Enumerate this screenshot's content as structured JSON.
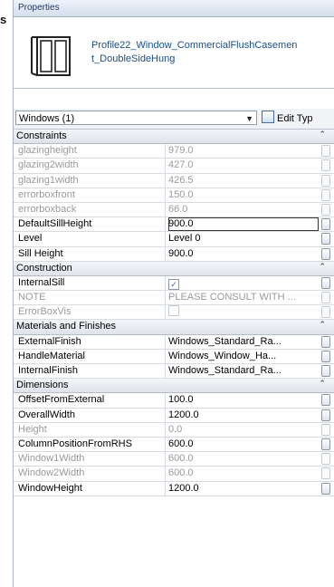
{
  "edge_text": "s",
  "title": "Properties",
  "type_name": "Profile22_Window_CommercialFlushCasement_DoubleSideHung",
  "selector": {
    "value": "Windows (1)",
    "edit_type_label": "Edit Typ"
  },
  "groups": [
    {
      "label": "Constraints",
      "rows": [
        {
          "name": "glazingheight",
          "value": "979.0",
          "state": "disabled"
        },
        {
          "name": "glazing2width",
          "value": "427.0",
          "state": "disabled"
        },
        {
          "name": "glazing1width",
          "value": "426.5",
          "state": "disabled"
        },
        {
          "name": "errorboxfront",
          "value": "150.0",
          "state": "disabled"
        },
        {
          "name": "errorboxback",
          "value": "66.0",
          "state": "disabled"
        },
        {
          "name": "DefaultSillHeight",
          "value": "900.0",
          "state": "selected"
        },
        {
          "name": "Level",
          "value": "Level 0",
          "state": "normal"
        },
        {
          "name": "Sill Height",
          "value": "900.0",
          "state": "normal"
        }
      ]
    },
    {
      "label": "Construction",
      "rows": [
        {
          "name": "InternalSill",
          "value": "",
          "state": "checkbox-checked"
        },
        {
          "name": "NOTE",
          "value": "PLEASE CONSULT WITH ...",
          "state": "disabled"
        },
        {
          "name": "ErrorBoxVis",
          "value": "",
          "state": "checkbox-disabled"
        }
      ]
    },
    {
      "label": "Materials and Finishes",
      "rows": [
        {
          "name": "ExternalFinish",
          "value": "Windows_Standard_Ra...",
          "state": "normal"
        },
        {
          "name": "HandleMaterial",
          "value": "Windows_Window_Ha...",
          "state": "normal"
        },
        {
          "name": "InternalFinish",
          "value": "Windows_Standard_Ra...",
          "state": "normal"
        }
      ]
    },
    {
      "label": "Dimensions",
      "rows": [
        {
          "name": "OffsetFromExternal",
          "value": "100.0",
          "state": "normal"
        },
        {
          "name": "OverallWidth",
          "value": "1200.0",
          "state": "normal"
        },
        {
          "name": "Height",
          "value": "0.0",
          "state": "disabled"
        },
        {
          "name": "ColumnPositionFromRHS",
          "value": "600.0",
          "state": "normal"
        },
        {
          "name": "Window1Width",
          "value": "600.0",
          "state": "disabled"
        },
        {
          "name": "Window2Width",
          "value": "600.0",
          "state": "disabled"
        },
        {
          "name": "WindowHeight",
          "value": "1200.0",
          "state": "normal"
        }
      ]
    }
  ],
  "icons": {
    "collapse": "chevron-up-icon",
    "dropdown": "chevron-down-icon",
    "edit_type": "edit-type-icon",
    "family": "window-family-thumbnail-icon"
  }
}
